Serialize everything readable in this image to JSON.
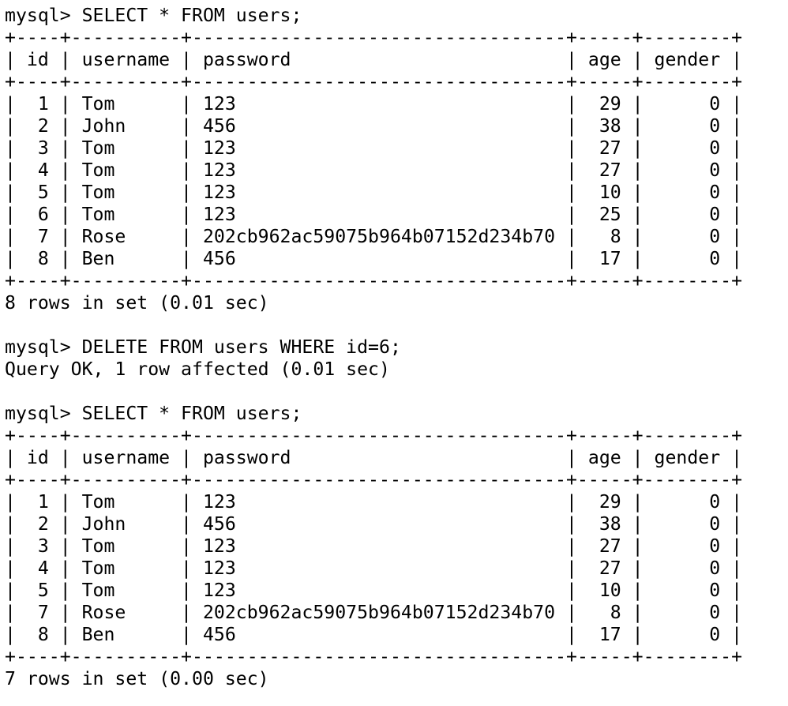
{
  "terminal": {
    "app": "mysql",
    "prompt": "mysql> ",
    "colors": {
      "background": "#ffffff",
      "foreground": "#000000"
    },
    "columns": {
      "id": 4,
      "username": 10,
      "password": 34,
      "age": 5,
      "gender": 8
    }
  },
  "table": {
    "headers": [
      "id",
      "username",
      "password",
      "age",
      "gender"
    ],
    "align": [
      "right",
      "left",
      "left",
      "right",
      "right"
    ]
  },
  "session": [
    {
      "type": "command",
      "prompt": "mysql> ",
      "text": "SELECT * FROM users;"
    },
    {
      "type": "result_table",
      "headers": [
        "id",
        "username",
        "password",
        "age",
        "gender"
      ],
      "rows": [
        [
          "1",
          "Tom",
          "123",
          "29",
          "0"
        ],
        [
          "2",
          "John",
          "456",
          "38",
          "0"
        ],
        [
          "3",
          "Tom",
          "123",
          "27",
          "0"
        ],
        [
          "4",
          "Tom",
          "123",
          "27",
          "0"
        ],
        [
          "5",
          "Tom",
          "123",
          "10",
          "0"
        ],
        [
          "6",
          "Tom",
          "123",
          "25",
          "0"
        ],
        [
          "7",
          "Rose",
          "202cb962ac59075b964b07152d234b70",
          "8",
          "0"
        ],
        [
          "8",
          "Ben",
          "456",
          "17",
          "0"
        ]
      ],
      "status": "8 rows in set (0.01 sec)"
    },
    {
      "type": "blank"
    },
    {
      "type": "command",
      "prompt": "mysql> ",
      "text": "DELETE FROM users WHERE id=6;"
    },
    {
      "type": "status",
      "text": "Query OK, 1 row affected (0.01 sec)"
    },
    {
      "type": "blank"
    },
    {
      "type": "command",
      "prompt": "mysql> ",
      "text": "SELECT * FROM users;"
    },
    {
      "type": "result_table",
      "headers": [
        "id",
        "username",
        "password",
        "age",
        "gender"
      ],
      "rows": [
        [
          "1",
          "Tom",
          "123",
          "29",
          "0"
        ],
        [
          "2",
          "John",
          "456",
          "38",
          "0"
        ],
        [
          "3",
          "Tom",
          "123",
          "27",
          "0"
        ],
        [
          "4",
          "Tom",
          "123",
          "27",
          "0"
        ],
        [
          "5",
          "Tom",
          "123",
          "10",
          "0"
        ],
        [
          "7",
          "Rose",
          "202cb962ac59075b964b07152d234b70",
          "8",
          "0"
        ],
        [
          "8",
          "Ben",
          "456",
          "17",
          "0"
        ]
      ],
      "status": "7 rows in set (0.00 sec)"
    }
  ]
}
